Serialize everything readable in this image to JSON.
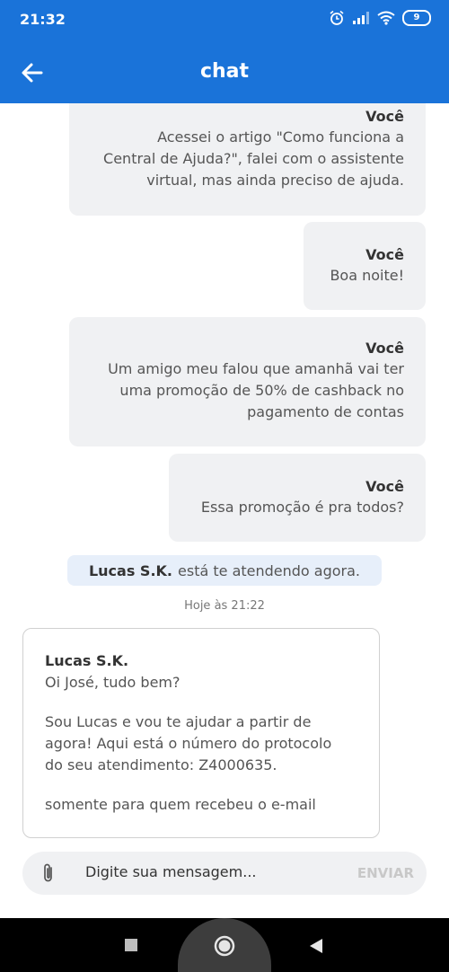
{
  "status_bar": {
    "time": "21:32",
    "battery_level": "9",
    "icons": [
      "alarm-icon",
      "signal-icon",
      "wifi-icon",
      "battery-icon"
    ]
  },
  "header": {
    "title": "chat",
    "back_icon": "arrow-left-icon"
  },
  "messages": [
    {
      "sender": "Você",
      "lines": [
        "Acessei o artigo \"Como funciona a",
        "Central de Ajuda?\", falei com o assistente",
        "virtual, mas ainda preciso de ajuda."
      ]
    },
    {
      "sender": "Você",
      "lines": [
        "Boa noite!"
      ]
    },
    {
      "sender": "Você",
      "lines": [
        "Um amigo meu falou que amanhã vai ter",
        "uma promoção de 50% de cashback no",
        "pagamento de contas"
      ]
    },
    {
      "sender": "Você",
      "lines": [
        "Essa promoção é pra todos?"
      ]
    }
  ],
  "attendant_status": {
    "name": "Lucas S.K.",
    "text": "está te atendendo agora."
  },
  "timestamp": "Hoje às 21:22",
  "agent_message": {
    "sender": "Lucas S.K.",
    "line1": "Oi José, tudo bem?",
    "line2": "Sou Lucas e vou te ajudar a partir de",
    "line3": "agora! Aqui está o número do protocolo",
    "line4": "do seu atendimento: Z4000635.",
    "line5": "somente para quem recebeu o e-mail"
  },
  "composer": {
    "placeholder": "Digite sua mensagem...",
    "send_label": "ENVIAR",
    "attach_icon": "paperclip-icon"
  },
  "colors": {
    "brand": "#1a73d9",
    "bubble_bg": "#f0f1f3",
    "status_pill_bg": "#e7effa"
  },
  "nav_bar": {
    "icons": [
      "recent-apps-icon",
      "home-icon",
      "back-icon"
    ]
  }
}
